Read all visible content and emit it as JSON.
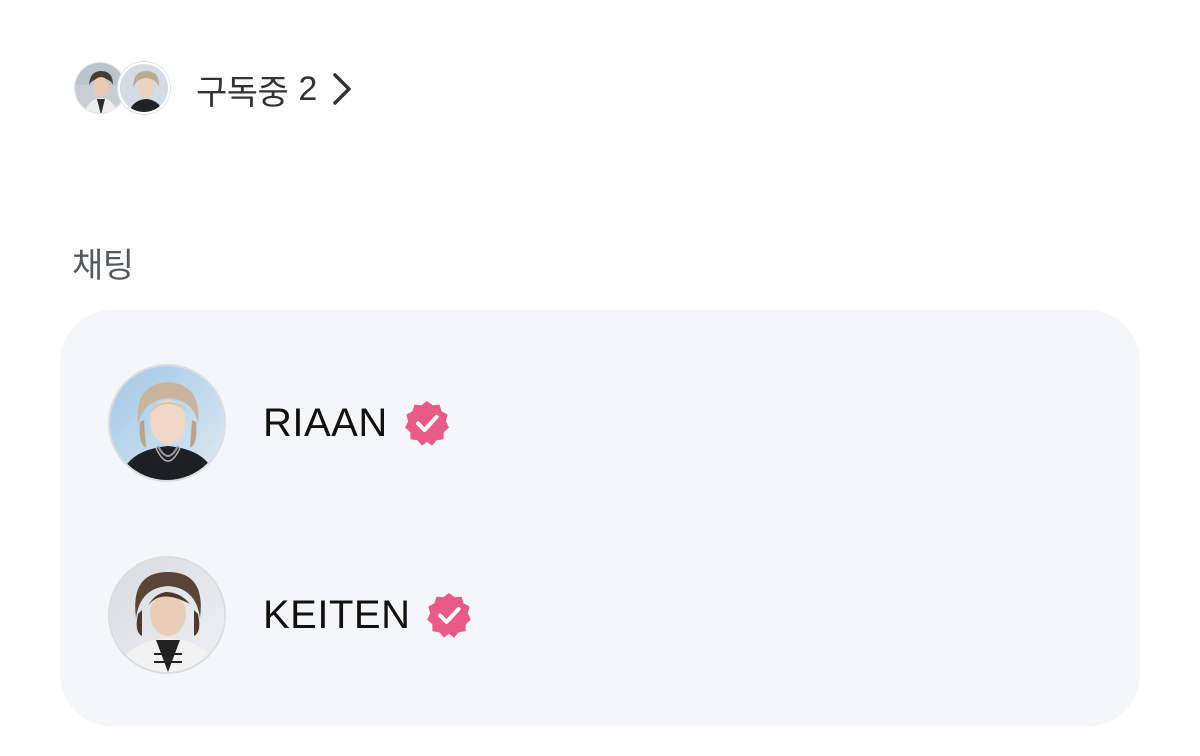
{
  "subscriptions": {
    "label": "구독중",
    "count": "2",
    "avatars": [
      "member-photo-avatar",
      "member-photo-avatar"
    ],
    "chevron_icon": "chevron-right-icon"
  },
  "chat_section": {
    "title": "채팅",
    "rooms": [
      {
        "name": "RIAAN",
        "verified": true,
        "avatar": "member-photo-avatar"
      },
      {
        "name": "KEITEN",
        "verified": true,
        "avatar": "member-photo-avatar"
      }
    ]
  },
  "colors": {
    "verified_badge": "#ea5a86",
    "card_background": "#f5f6f8",
    "text_primary": "#111111",
    "text_secondary": "#555a61"
  }
}
